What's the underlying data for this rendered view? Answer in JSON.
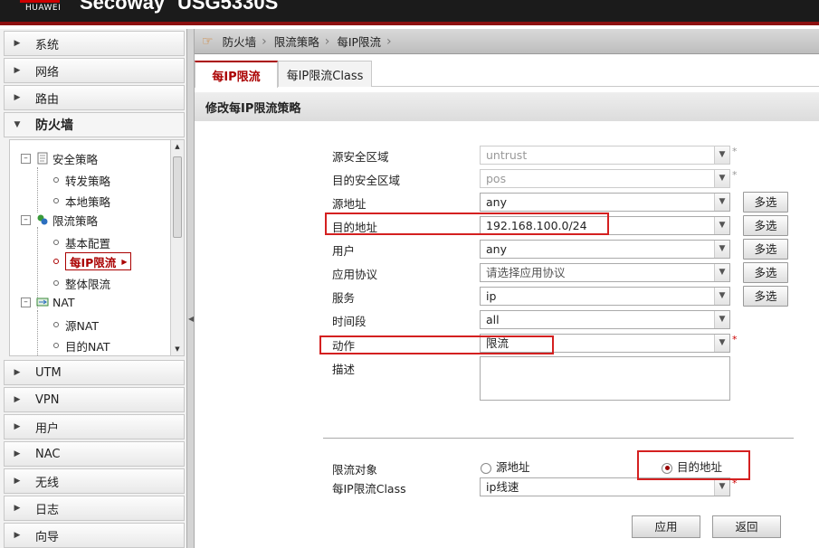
{
  "header": {
    "vendor": "HUAWEI",
    "brand": "Secoway",
    "model": "USG5330S"
  },
  "sidebar": {
    "items": [
      {
        "label": "系统"
      },
      {
        "label": "网络"
      },
      {
        "label": "路由"
      },
      {
        "label": "防火墙"
      },
      {
        "label": "UTM"
      },
      {
        "label": "VPN"
      },
      {
        "label": "用户"
      },
      {
        "label": "NAC"
      },
      {
        "label": "无线"
      },
      {
        "label": "日志"
      },
      {
        "label": "向导"
      }
    ],
    "tree": {
      "security_policy": "安全策略",
      "forward_policy": "转发策略",
      "local_policy": "本地策略",
      "limit_policy": "限流策略",
      "basic_config": "基本配置",
      "per_ip_limit": "每IP限流",
      "overall_limit": "整体限流",
      "nat": "NAT",
      "source_nat": "源NAT",
      "dest_nat": "目的NAT"
    }
  },
  "breadcrumb": {
    "items": [
      "防火墙",
      "限流策略",
      "每IP限流"
    ]
  },
  "tabs": [
    {
      "label": "每IP限流"
    },
    {
      "label": "每IP限流Class"
    }
  ],
  "section": {
    "title": "修改每IP限流策略"
  },
  "form": {
    "fields": [
      {
        "label": "源安全区域",
        "value": "untrust"
      },
      {
        "label": "目的安全区域",
        "value": "pos"
      },
      {
        "label": "源地址",
        "value": "any"
      },
      {
        "label": "目的地址",
        "value": "192.168.100.0/24"
      },
      {
        "label": "用户",
        "value": "any"
      },
      {
        "label": "应用协议",
        "value": "请选择应用协议"
      },
      {
        "label": "服务",
        "value": "ip"
      },
      {
        "label": "时间段",
        "value": "all"
      },
      {
        "label": "动作",
        "value": "限流"
      },
      {
        "label": "描述",
        "value": ""
      }
    ],
    "required_mark": "*",
    "multi_select_label": "多选",
    "limit_target": {
      "label": "限流对象",
      "option_source": "源地址",
      "option_dest": "目的地址",
      "selected": "目的地址"
    },
    "class_field": {
      "label": "每IP限流Class",
      "value": "ip线速"
    }
  },
  "buttons": {
    "apply": "应用",
    "back": "返回"
  }
}
